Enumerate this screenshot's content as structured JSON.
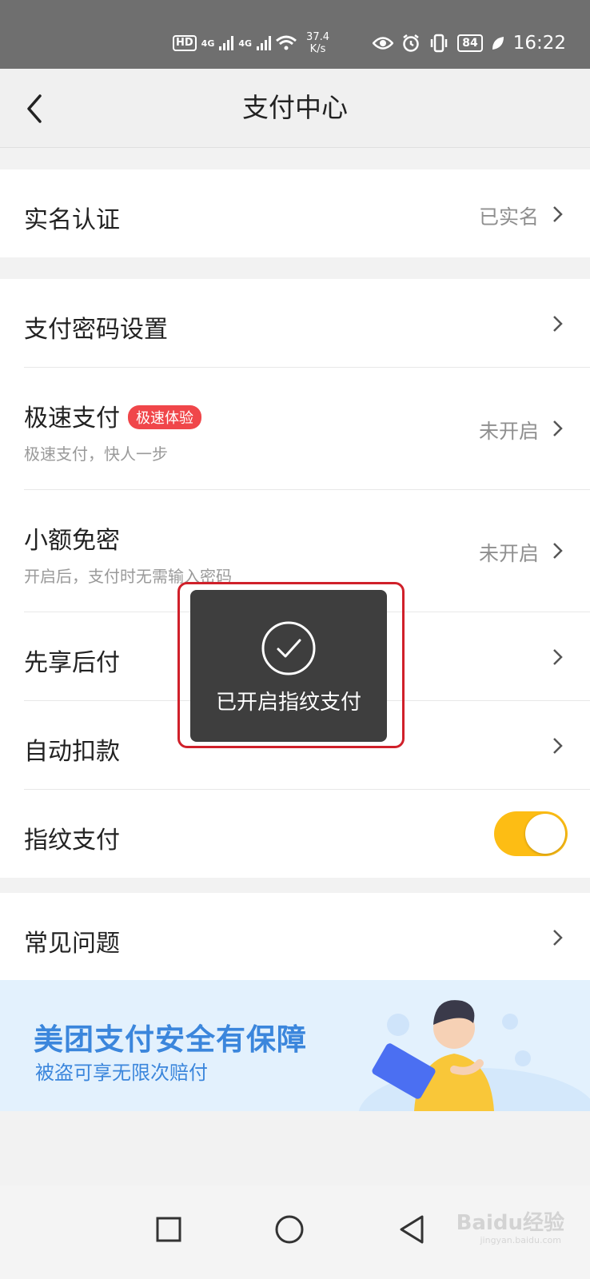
{
  "status_bar": {
    "hd": "HD",
    "net1": "4G",
    "net2": "4G",
    "speed_value": "37.4",
    "speed_unit": "K/s",
    "battery": "84",
    "time": "16:22"
  },
  "header": {
    "title": "支付中心"
  },
  "section1": {
    "real_name": {
      "label": "实名认证",
      "value": "已实名"
    }
  },
  "section2": {
    "pay_password": {
      "label": "支付密码设置"
    },
    "fast_pay": {
      "label": "极速支付",
      "badge": "极速体验",
      "sub": "极速支付，快人一步",
      "value": "未开启"
    },
    "small_free": {
      "label": "小额免密",
      "sub": "开启后，支付时无需输入密码",
      "value": "未开启"
    },
    "pay_later": {
      "label": "先享后付"
    },
    "auto_deduct": {
      "label": "自动扣款"
    },
    "fingerprint": {
      "label": "指纹支付",
      "enabled": true,
      "toggle_color": "#fdbd14"
    }
  },
  "section3": {
    "faq": {
      "label": "常见问题"
    }
  },
  "banner": {
    "title": "美团支付安全有保障",
    "subtitle": "被盗可享无限次赔付",
    "accent": "#3b86dc"
  },
  "toast": {
    "message": "已开启指纹支付",
    "icon": "check-circle-icon"
  },
  "watermark": {
    "brand": "Baidu经验",
    "url": "jingyan.baidu.com"
  }
}
